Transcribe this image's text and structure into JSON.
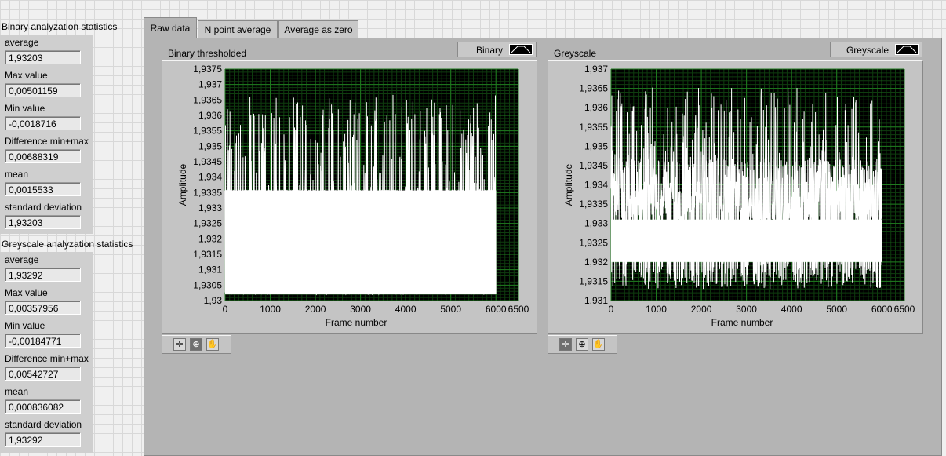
{
  "binary_stats": {
    "title": "Binary analyzation statistics",
    "items": [
      {
        "label": "average",
        "value": "1,93203"
      },
      {
        "label": "Max value",
        "value": "0,00501159"
      },
      {
        "label": "Min value",
        "value": "-0,0018716"
      },
      {
        "label": "Difference min+max",
        "value": "0,00688319"
      },
      {
        "label": "mean",
        "value": "0,0015533"
      },
      {
        "label": "standard deviation",
        "value": "1,93203"
      }
    ]
  },
  "greyscale_stats": {
    "title": "Greyscale analyzation statistics",
    "items": [
      {
        "label": "average",
        "value": "1,93292"
      },
      {
        "label": "Max value",
        "value": "0,00357956"
      },
      {
        "label": "Min value",
        "value": "-0,00184771"
      },
      {
        "label": "Difference min+max",
        "value": "0,00542727"
      },
      {
        "label": "mean",
        "value": "0,000836082"
      },
      {
        "label": "standard deviation",
        "value": "1,93292"
      }
    ]
  },
  "tabs": [
    {
      "label": "Raw data",
      "active": true
    },
    {
      "label": "N point average",
      "active": false
    },
    {
      "label": "Average as zero",
      "active": false
    }
  ],
  "graphs": {
    "binary": {
      "title": "Binary thresholded",
      "legend": "Binary",
      "xlabel": "Frame number",
      "ylabel": "Amplitude",
      "x_ticks": [
        "0",
        "1000",
        "2000",
        "3000",
        "4000",
        "5000",
        "6000",
        "6500"
      ],
      "y_ticks": [
        "1,93",
        "1,9305",
        "1,931",
        "1,9315",
        "1,932",
        "1,9325",
        "1,933",
        "1,9335",
        "1,934",
        "1,9345",
        "1,935",
        "1,9355",
        "1,936",
        "1,9365",
        "1,937",
        "1,9375"
      ]
    },
    "greyscale": {
      "title": "Greyscale",
      "legend": "Greyscale",
      "xlabel": "Frame number",
      "ylabel": "Amplitude",
      "x_ticks": [
        "0",
        "1000",
        "2000",
        "3000",
        "4000",
        "5000",
        "6000",
        "6500"
      ],
      "y_ticks": [
        "1,931",
        "1,9315",
        "1,932",
        "1,9325",
        "1,933",
        "1,9335",
        "1,934",
        "1,9345",
        "1,935",
        "1,9355",
        "1,936",
        "1,9365",
        "1,937"
      ]
    }
  },
  "chart_data": [
    {
      "type": "line",
      "title": "Binary thresholded",
      "xlabel": "Frame number",
      "ylabel": "Amplitude",
      "xlim": [
        0,
        6500
      ],
      "ylim": [
        1.93,
        1.9375
      ],
      "grid": true,
      "legend_position": "top-right",
      "series": [
        {
          "name": "Binary",
          "color": "#ffffff",
          "x_range": [
            0,
            6000
          ],
          "dense_band": [
            1.9302,
            1.93357
          ],
          "upper_spikes_max": 1.93668,
          "lower_spikes_min": 1.9302
        }
      ]
    },
    {
      "type": "line",
      "title": "Greyscale",
      "xlabel": "Frame number",
      "ylabel": "Amplitude",
      "xlim": [
        0,
        6500
      ],
      "ylim": [
        1.931,
        1.937
      ],
      "grid": true,
      "legend_position": "top-right",
      "series": [
        {
          "name": "Greyscale",
          "color": "#ffffff",
          "x_range": [
            0,
            6000
          ],
          "dense_band": [
            1.932,
            1.9331
          ],
          "upper_spikes_max": 1.93652,
          "lower_spikes_min": 1.9313
        }
      ]
    }
  ],
  "colors": {
    "plot_bg": "#000000",
    "grid": "#1f7a1f",
    "trace": "#ffffff",
    "panel": "#b4b4b4"
  },
  "graph_tools": [
    "crosshair-icon",
    "zoom-icon",
    "pan-hand-icon"
  ]
}
